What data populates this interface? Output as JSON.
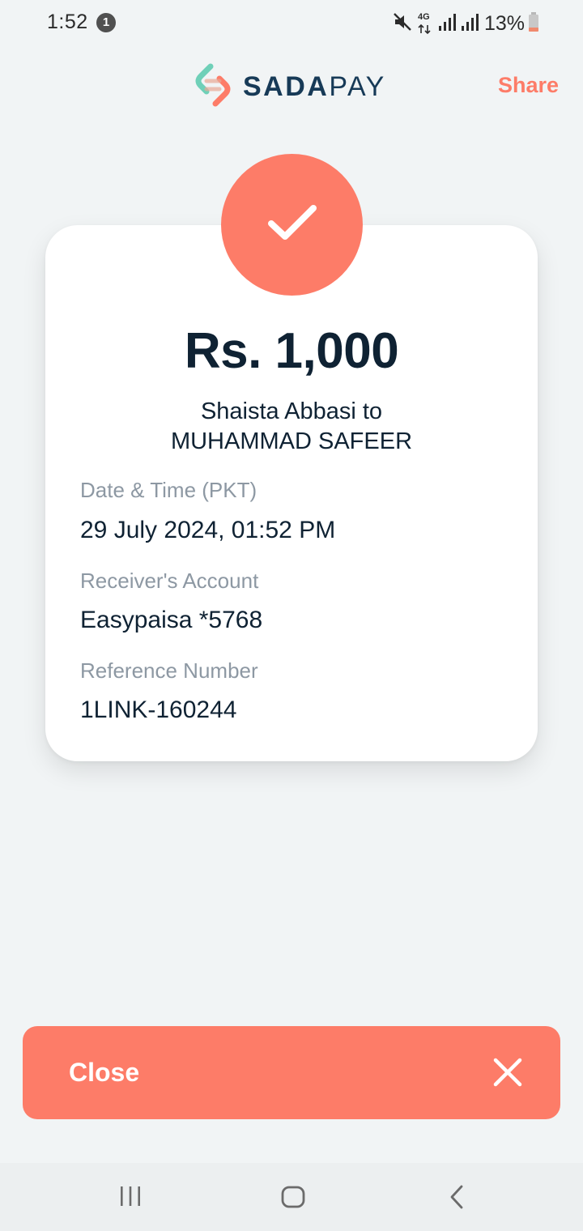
{
  "status_bar": {
    "time": "1:52",
    "notification_count": "1",
    "network": "4G",
    "battery": "13%",
    "icons": [
      "mute-icon",
      "4g-icon",
      "signal-icon",
      "signal-icon",
      "battery-icon"
    ]
  },
  "header": {
    "brand_bold": "SADA",
    "brand_light": "PAY",
    "share_label": "Share"
  },
  "receipt": {
    "status_icon": "check-icon",
    "amount": "Rs. 1,000",
    "sender_line": "Shaista Abbasi to",
    "receiver_line": "MUHAMMAD SAFEER",
    "fields": [
      {
        "label": "Date & Time (PKT)",
        "value": "29 July 2024, 01:52 PM"
      },
      {
        "label": "Receiver's Account",
        "value": "Easypaisa *5768"
      },
      {
        "label": "Reference Number",
        "value": "1LINK-160244"
      }
    ]
  },
  "footer": {
    "close_label": "Close",
    "close_icon": "close-icon"
  },
  "nav": [
    "recents-icon",
    "home-icon",
    "back-icon"
  ],
  "colors": {
    "accent": "#fd7c68",
    "brand_dark": "#173a57",
    "brand_teal": "#6fd0b8",
    "text_dark": "#0f2233",
    "label_gray": "#8d98a3",
    "background": "#f1f4f5"
  }
}
